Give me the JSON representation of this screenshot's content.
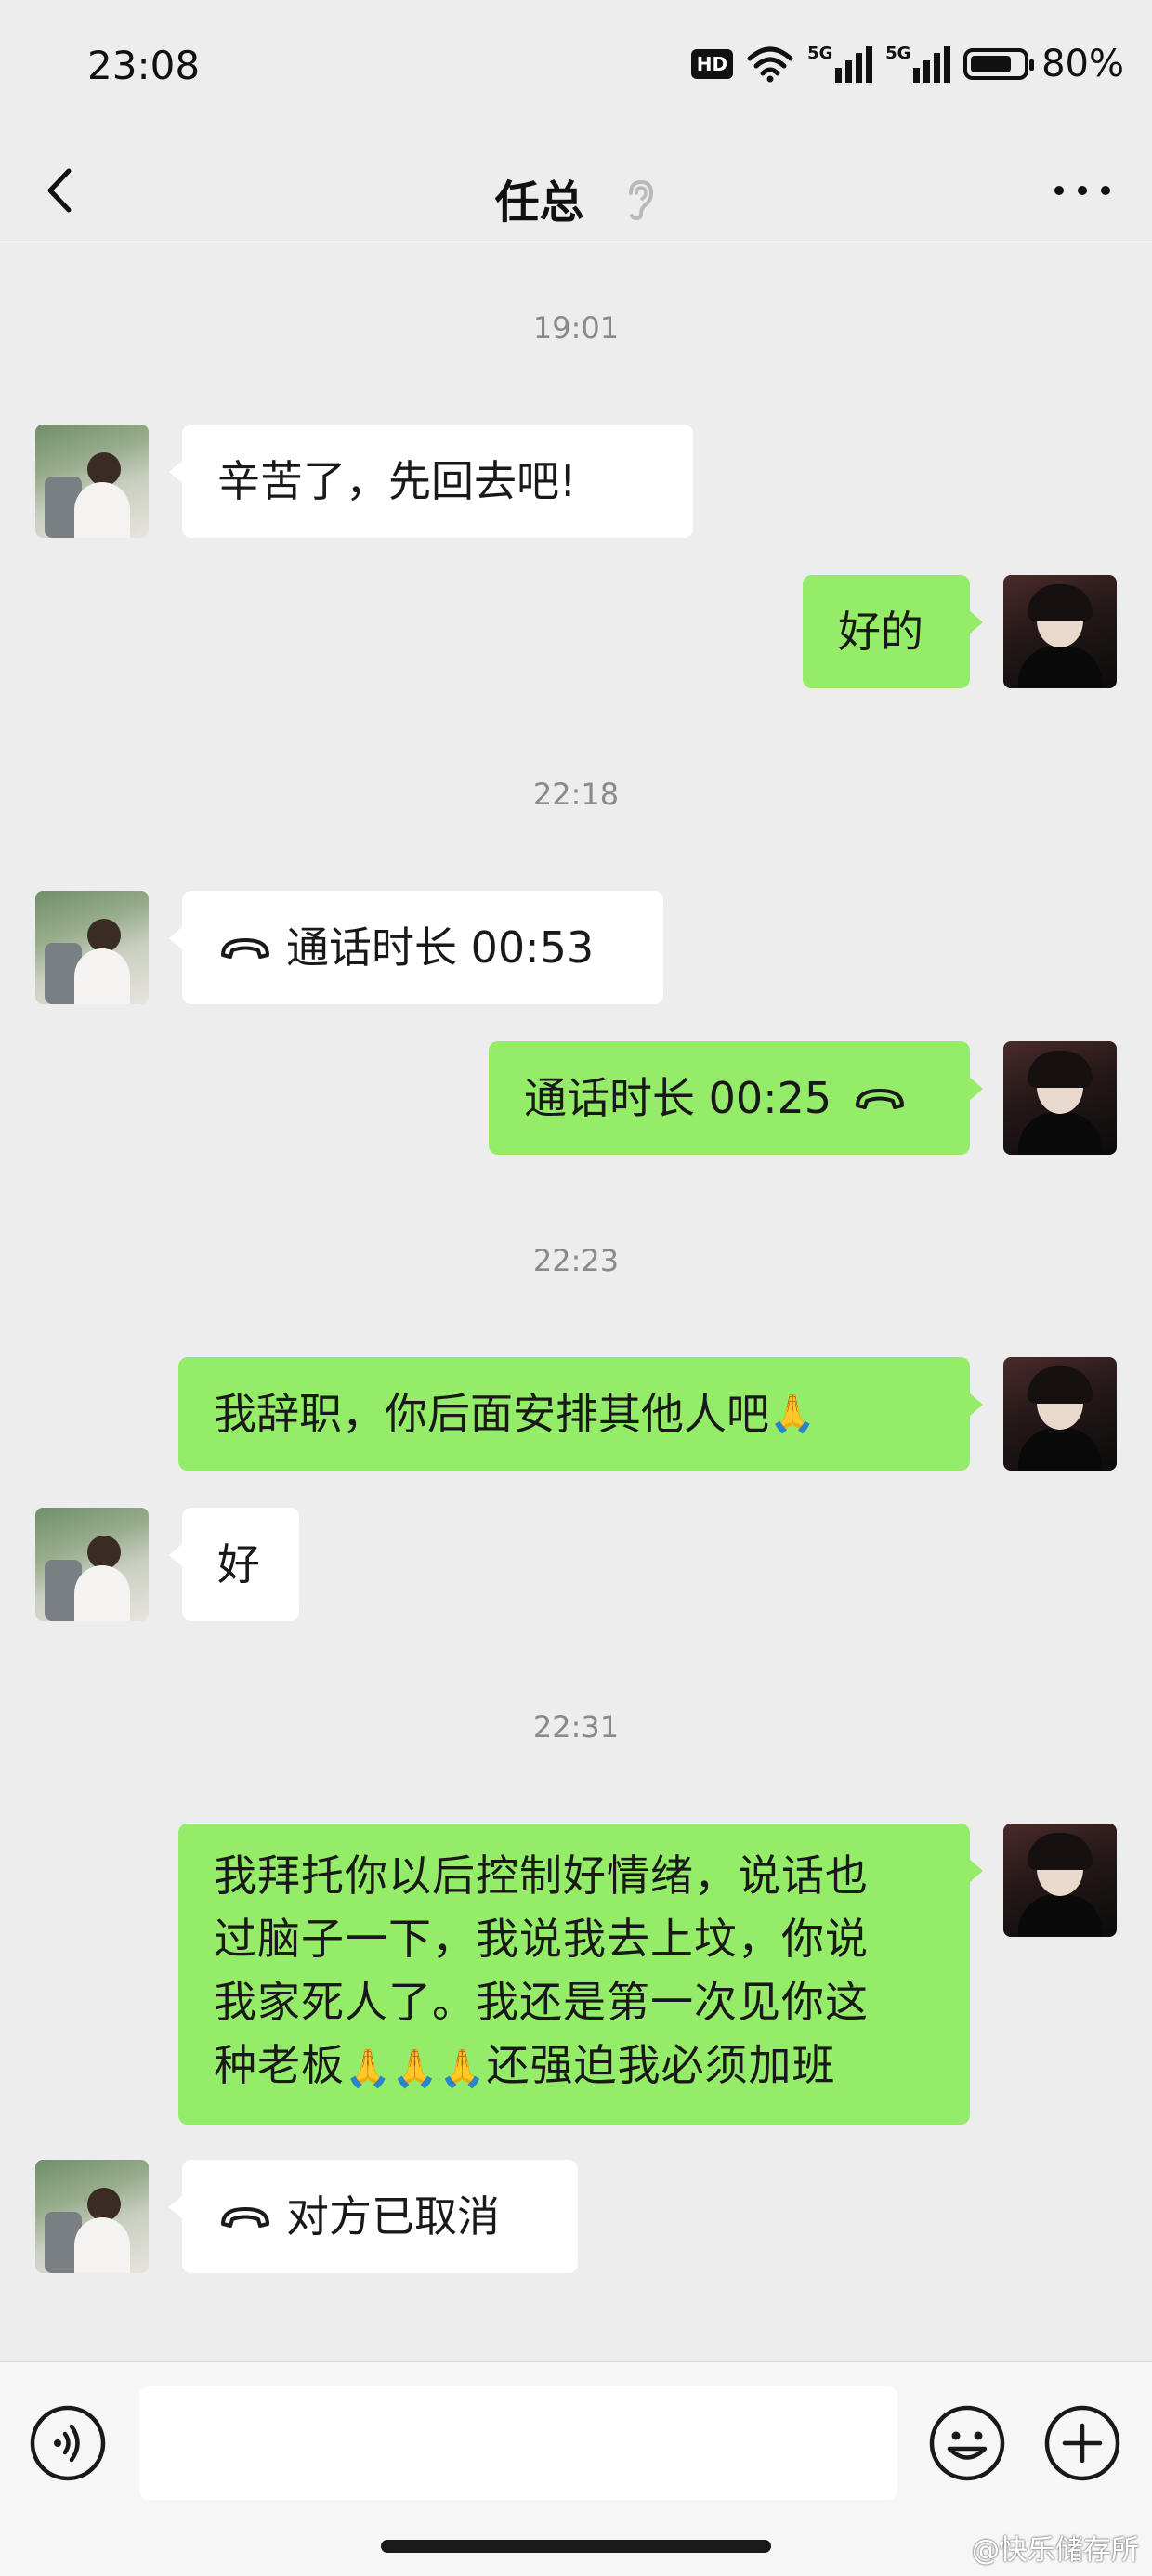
{
  "status_bar": {
    "time": "23:08",
    "hd_label": "HD",
    "signal_1_label": "5G",
    "signal_2_label": "5G",
    "battery_percent_value": 0.8,
    "battery_text": "80%"
  },
  "header": {
    "title": "任总",
    "back_icon": "chevron-left-icon",
    "earpiece_icon": "ear-icon",
    "more_icon": "more-dots-icon"
  },
  "messages": [
    {
      "type": "timestamp",
      "text": "19:01"
    },
    {
      "type": "text",
      "side": "in",
      "text": "辛苦了，先回去吧!"
    },
    {
      "type": "text",
      "side": "out",
      "text": "好的"
    },
    {
      "type": "timestamp",
      "text": "22:18"
    },
    {
      "type": "call",
      "side": "in",
      "text": "通话时长 00:53"
    },
    {
      "type": "call",
      "side": "out",
      "text": "通话时长 00:25"
    },
    {
      "type": "timestamp",
      "text": "22:23"
    },
    {
      "type": "text",
      "side": "out",
      "text": "我辞职，你后面安排其他人吧"
    },
    {
      "type": "text",
      "side": "in",
      "text": "好"
    },
    {
      "type": "timestamp",
      "text": "22:31"
    },
    {
      "type": "text",
      "side": "out",
      "lines": [
        "我拜托你以后控制好情绪，说话也",
        "过脑子一下，我说我去上坟，你说",
        "我家死人了。我还是第一次见你这",
        "还强迫我必须加班"
      ]
    },
    {
      "type": "call",
      "side": "in",
      "text": "对方已取消"
    }
  ],
  "emoji_praying_hands": "🙏",
  "input_bar": {
    "voice_icon": "voice-input-icon",
    "emoji_icon": "smiley-icon",
    "plus_icon": "plus-icon",
    "input_value": ""
  },
  "watermark": "@快乐储存所",
  "colors": {
    "background": "#ededed",
    "incoming_bubble": "#ffffff",
    "outgoing_bubble": "#95ec69",
    "timestamp_text": "#8a8a8a"
  }
}
